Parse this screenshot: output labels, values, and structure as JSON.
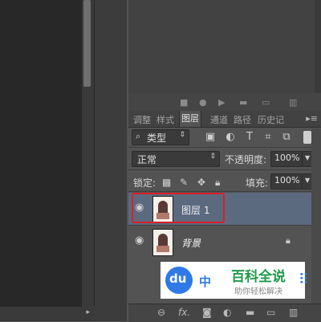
{
  "tabs": [
    {
      "label": "调整"
    },
    {
      "label": "样式"
    },
    {
      "label": "图层"
    },
    {
      "label": "通道"
    },
    {
      "label": "路径"
    },
    {
      "label": "历史记"
    }
  ],
  "active_tab": "图层",
  "filter": {
    "kind_label": "类型"
  },
  "blend_mode": {
    "value": "正常"
  },
  "opacity": {
    "label": "不透明度:",
    "value": "100%"
  },
  "lock": {
    "label": "锁定:"
  },
  "fill": {
    "label": "填充:",
    "value": "100%"
  },
  "layers": [
    {
      "name": "图层 1",
      "selected": true,
      "visible": true
    },
    {
      "name": "背景",
      "selected": false,
      "visible": true,
      "locked": true
    }
  ],
  "bottom_bar": {
    "fx_label": "fx."
  },
  "watermark": {
    "title": "百科全说",
    "subtitle": "助你轻松解决",
    "logo_text": "du",
    "extra": "中"
  },
  "colors": {
    "selected_row": "#5c6a80",
    "highlight_border": "#d81f26",
    "watermark_blue": "#2f79e6",
    "watermark_green": "#1f9a4a"
  }
}
